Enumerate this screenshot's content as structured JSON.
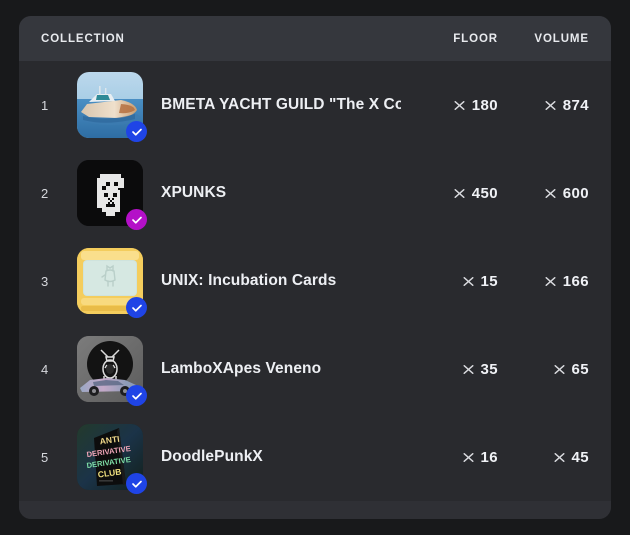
{
  "table": {
    "columns": {
      "collection": "COLLECTION",
      "floor": "FLOOR",
      "volume": "VOLUME"
    },
    "currency_icon": "x-cross-icon",
    "verified_icon": "verified-check-icon",
    "colors": {
      "page_background": "#18191b",
      "panel_background": "#292a2e",
      "header_background": "#35373d",
      "footer_background": "#2f3035",
      "text_primary": "#edeff3",
      "verified_blue": "#1f44e6",
      "verified_purple": "#b410c8"
    },
    "rows": [
      {
        "rank": "1",
        "name": "BMETA YACHT GUILD \"The X Collec",
        "floor": "180",
        "volume": "874",
        "verified_color": "#1f44e6",
        "thumb": "yacht-thumbnail"
      },
      {
        "rank": "2",
        "name": "XPUNKS",
        "floor": "450",
        "volume": "600",
        "verified_color": "#b410c8",
        "thumb": "punk-thumbnail"
      },
      {
        "rank": "3",
        "name": "UNIX: Incubation Cards",
        "floor": "15",
        "volume": "166",
        "verified_color": "#1f44e6",
        "thumb": "card-thumbnail"
      },
      {
        "rank": "4",
        "name": "LamboXApes Veneno",
        "floor": "35",
        "volume": "65",
        "verified_color": "#1f44e6",
        "thumb": "lambo-ape-thumbnail"
      },
      {
        "rank": "5",
        "name": "DoodlePunkX",
        "floor": "16",
        "volume": "45",
        "verified_color": "#1f44e6",
        "thumb": "anti-derivative-club-thumbnail",
        "thumb_text": [
          "ANTI",
          "DERIVATIVE",
          "DERIVATIVE",
          "CLUB"
        ]
      }
    ]
  }
}
